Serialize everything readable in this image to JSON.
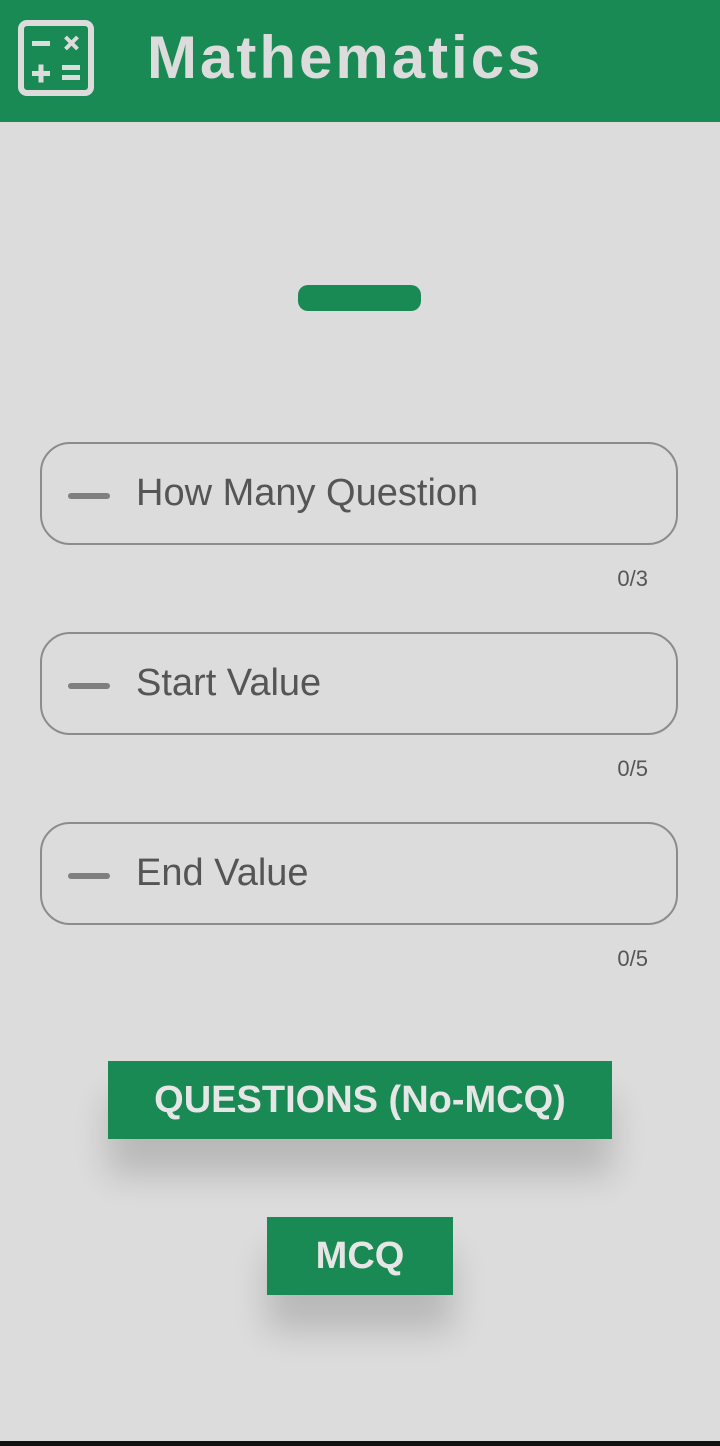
{
  "app_bar": {
    "icon": "calculator-icon",
    "title": "Mathematics",
    "color": "#1a8a55"
  },
  "form": {
    "fields": [
      {
        "placeholder": "How Many Question",
        "value": "",
        "counter": "0/3",
        "icon": "minus-icon"
      },
      {
        "placeholder": "Start Value",
        "value": "",
        "counter": "0/5",
        "icon": "minus-icon"
      },
      {
        "placeholder": "End Value",
        "value": "",
        "counter": "0/5",
        "icon": "minus-icon"
      }
    ]
  },
  "buttons": {
    "questions_label": "QUESTIONS (No-MCQ)",
    "mcq_label": "MCQ"
  },
  "colors": {
    "accent": "#1a8a55",
    "background": "#dcdcdc"
  }
}
